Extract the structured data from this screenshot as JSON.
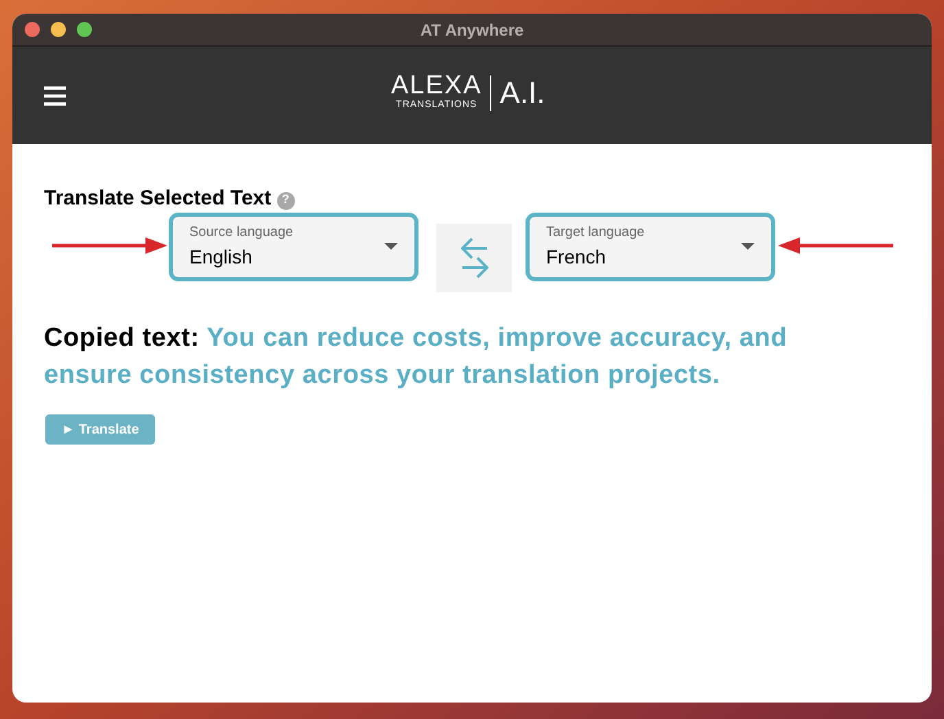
{
  "window": {
    "title": "AT Anywhere"
  },
  "header": {
    "logo": {
      "wordmark": "ALEXA",
      "subtitle": "TRANSLATIONS",
      "suffix": "A.I."
    }
  },
  "section": {
    "title": "Translate Selected Text",
    "help": "?"
  },
  "source": {
    "label": "Source language",
    "value": "English"
  },
  "target": {
    "label": "Target language",
    "value": "French"
  },
  "copied": {
    "label": "Copied text:",
    "text": "You can reduce costs, improve accuracy, and ensure consistency across your translation projects."
  },
  "translate_button": {
    "label": "► Translate"
  }
}
